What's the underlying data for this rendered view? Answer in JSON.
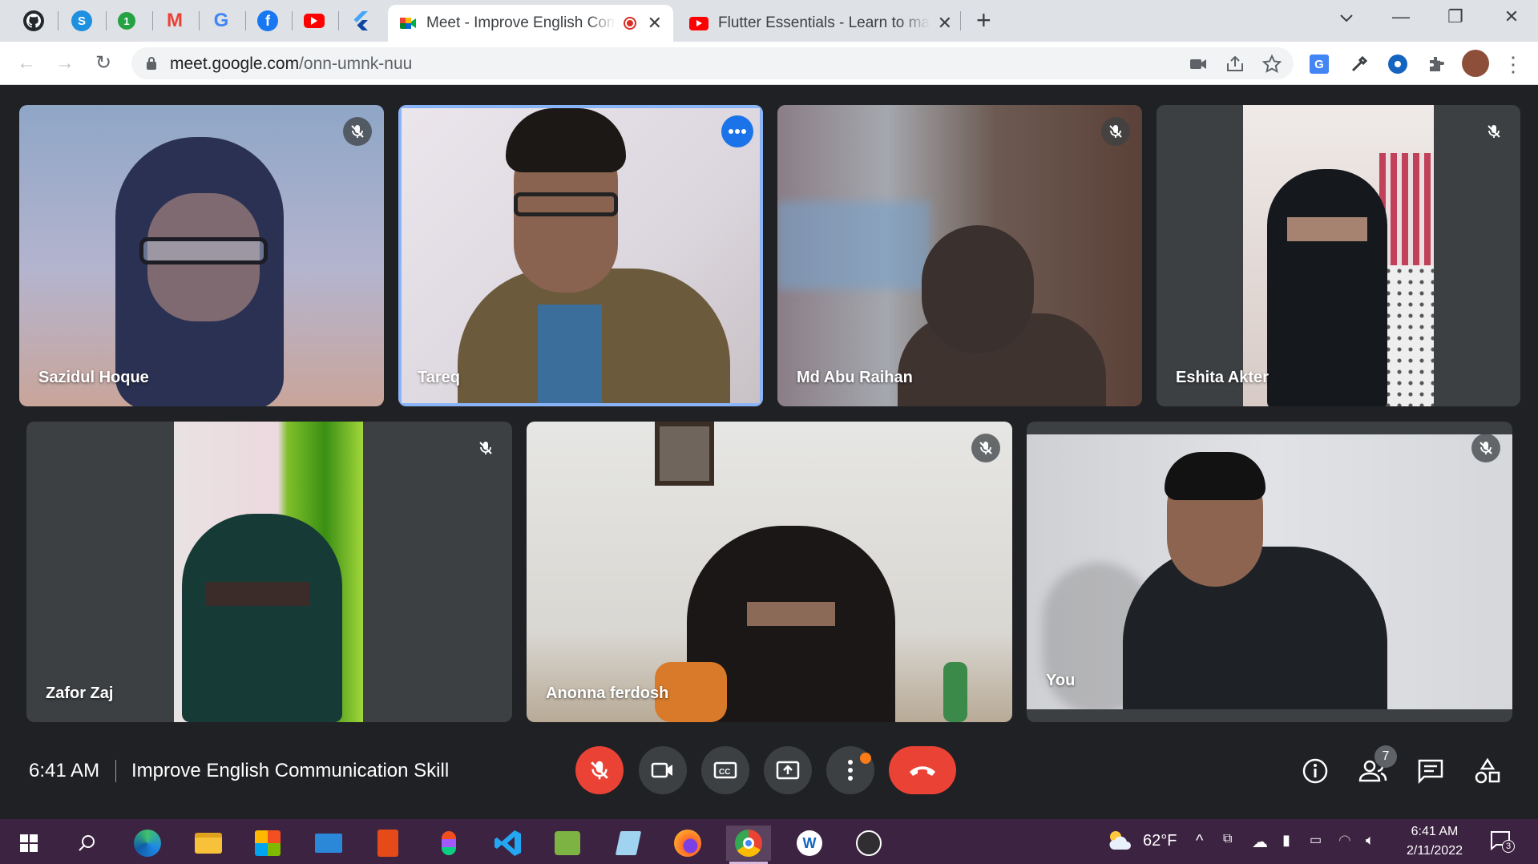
{
  "browser": {
    "pinned_tabs": [
      "github-icon",
      "skype-icon",
      "whatsapp-icon",
      "gmail-icon",
      "google-icon",
      "facebook-icon",
      "youtube-icon",
      "flutter-icon"
    ],
    "tabs": [
      {
        "title": "Meet - Improve English Communication Skill",
        "active": true
      },
      {
        "title": "Flutter Essentials - Learn to make",
        "active": false
      }
    ],
    "new_tab": "+",
    "url_host": "meet.google.com",
    "url_path": "/onn-umnk-nuu"
  },
  "participants": [
    {
      "name": "Sazidul Hoque"
    },
    {
      "name": "Tareq"
    },
    {
      "name": "Md Abu Raihan"
    },
    {
      "name": "Eshita Akter"
    },
    {
      "name": "Zafor Zaj"
    },
    {
      "name": "Anonna ferdosh"
    },
    {
      "name": "You"
    }
  ],
  "meeting": {
    "time": "6:41 AM",
    "separator": "|",
    "name": "Improve English Communication Skill",
    "people_count": "7"
  },
  "taskbar": {
    "weather": "62°F",
    "time": "6:41 AM",
    "date": "2/11/2022",
    "notifications": "3"
  },
  "colors": {
    "meet_bg": "#202124",
    "mic_off_red": "#ea4335",
    "speaking_outline": "#8ab4f8",
    "taskbar": "#3d2342"
  }
}
